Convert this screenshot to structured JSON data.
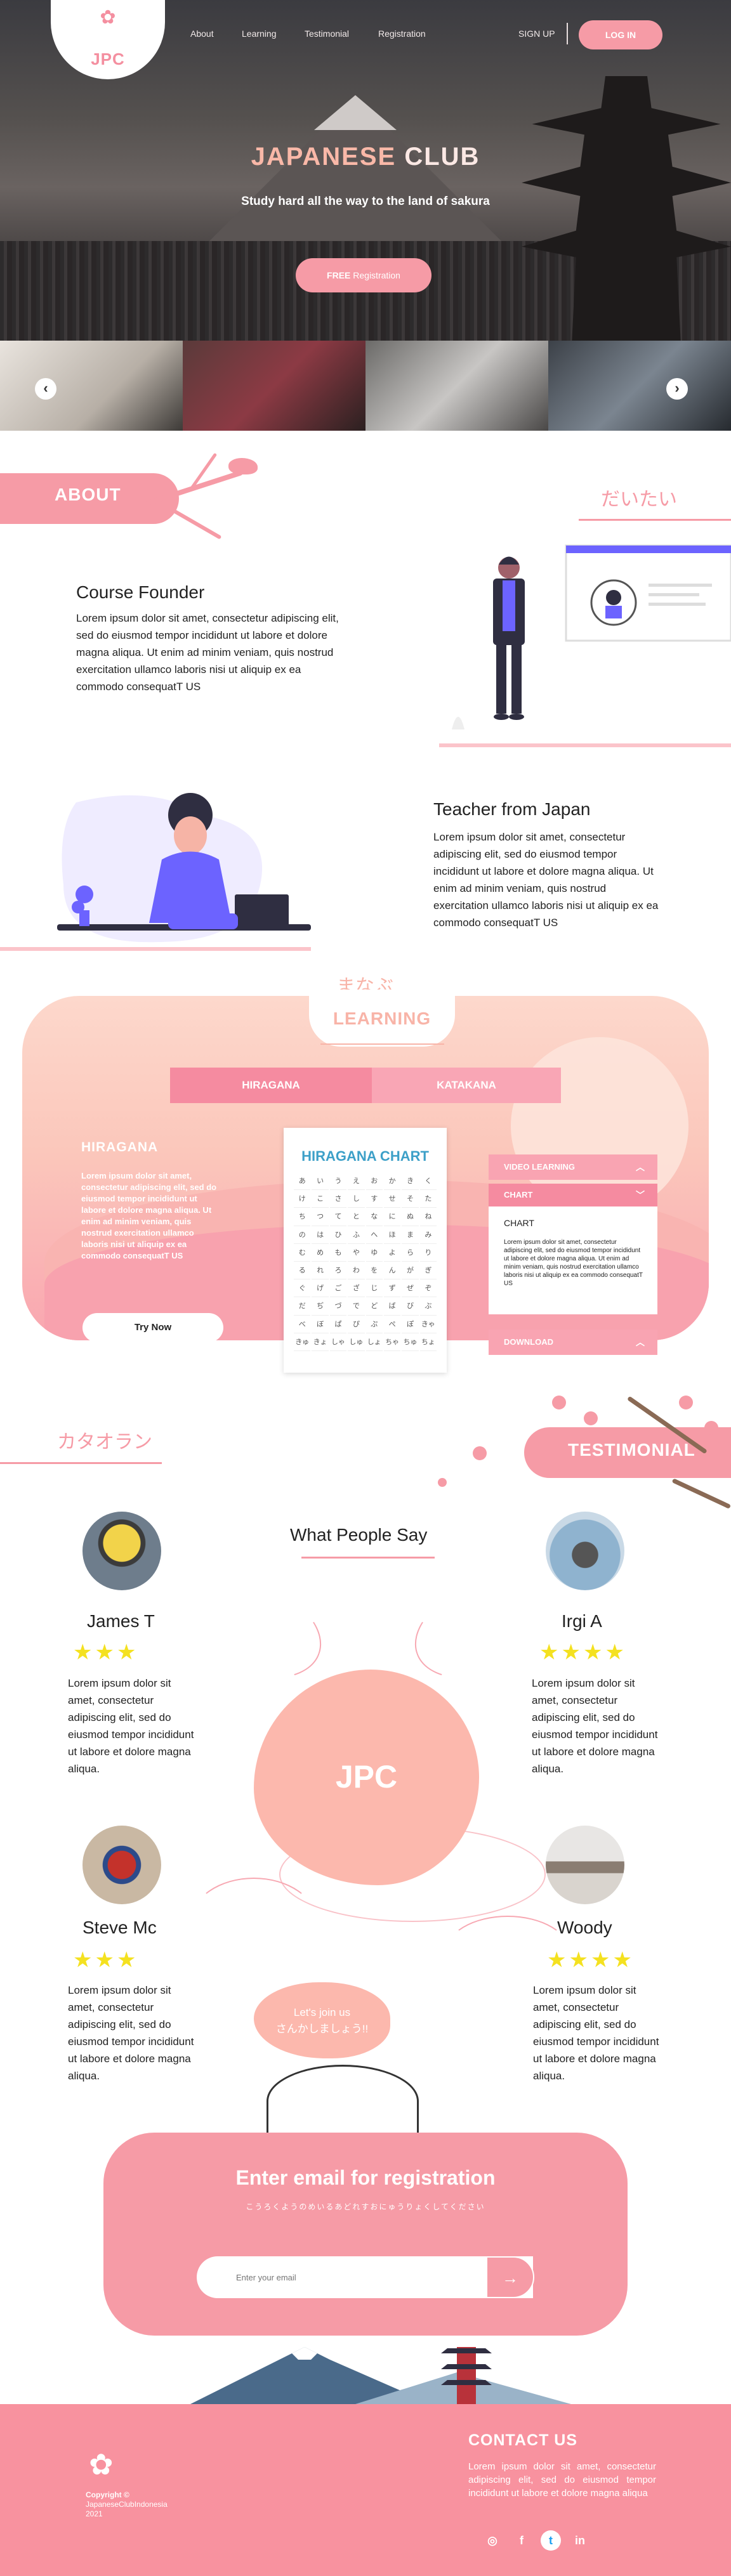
{
  "nav": {
    "logo": "JPC",
    "links": [
      "About",
      "Learning",
      "Testimonial",
      "Registration"
    ],
    "signup": "SIGN UP",
    "login": "LOG IN"
  },
  "hero": {
    "title_a": "JAPANESE",
    "title_b": " CLUB",
    "subtitle": "Study hard all the way to the land of sakura",
    "cta_bold": "FREE",
    "cta_rest": " Registration"
  },
  "about": {
    "title": "ABOUT",
    "jp": "だいたい",
    "founder_title": "Course Founder",
    "founder_text": "Lorem ipsum dolor sit amet, consectetur adipiscing elit, sed do eiusmod tempor incididunt ut labore et dolore magna aliqua. Ut enim ad minim veniam, quis nostrud exercitation ullamco laboris nisi ut aliquip ex ea commodo consequatT US",
    "teacher_title": "Teacher from Japan",
    "teacher_text": "Lorem ipsum dolor sit amet, consectetur adipiscing elit, sed do eiusmod tempor incididunt ut labore et dolore magna aliqua. Ut enim ad minim veniam, quis nostrud exercitation ullamco laboris nisi ut aliquip ex ea commodo consequatT US"
  },
  "learning": {
    "jp": "まなぶ",
    "title": "LEARNING",
    "tabs": [
      "HIRAGANA",
      "KATAKANA"
    ],
    "section_title": "HIRAGANA",
    "section_text": "Lorem ipsum dolor sit amet, consectetur adipiscing elit, sed do eiusmod tempor incididunt ut labore et dolore magna aliqua. Ut enim ad minim veniam, quis nostrud exercitation ullamco laboris nisi ut aliquip ex ea commodo consequatT US",
    "try_now": "Try Now",
    "chart_title": "HIRAGANA CHART",
    "chart_chars": [
      "あ",
      "い",
      "う",
      "え",
      "お",
      "か",
      "き",
      "く",
      "け",
      "こ",
      "さ",
      "し",
      "す",
      "せ",
      "そ",
      "た",
      "ち",
      "つ",
      "て",
      "と",
      "な",
      "に",
      "ぬ",
      "ね",
      "の",
      "は",
      "ひ",
      "ふ",
      "へ",
      "ほ",
      "ま",
      "み",
      "む",
      "め",
      "も",
      "や",
      "ゆ",
      "よ",
      "ら",
      "り",
      "る",
      "れ",
      "ろ",
      "わ",
      "を",
      "ん",
      "が",
      "ぎ",
      "ぐ",
      "げ",
      "ご",
      "ざ",
      "じ",
      "ず",
      "ぜ",
      "ぞ",
      "だ",
      "ぢ",
      "づ",
      "で",
      "ど",
      "ば",
      "び",
      "ぶ",
      "べ",
      "ぼ",
      "ぱ",
      "ぴ",
      "ぷ",
      "ぺ",
      "ぽ",
      "きゃ",
      "きゅ",
      "きょ",
      "しゃ",
      "しゅ",
      "しょ",
      "ちゃ",
      "ちゅ",
      "ちょ"
    ],
    "panel": {
      "video": "VIDEO LEARNING",
      "chart": "CHART",
      "chart_sub": "CHART",
      "chart_text": "Lorem ipsum dolor sit amet, consectetur adipiscing elit, sed do eiusmod tempor incididunt ut labore et dolore magna aliqua. Ut enim ad minim veniam, quis nostrud exercitation ullamco laboris nisi ut aliquip ex ea commodo consequatT US",
      "download": "DOWNLOAD"
    }
  },
  "testimonial": {
    "jp": "カタオラン",
    "title": "TESTIMONIAL",
    "heading": "What People Say",
    "center": "JPC",
    "people": [
      {
        "name": "James T",
        "stars": "★★★",
        "rating": 3,
        "text": "Lorem ipsum dolor sit amet, consectetur adipiscing elit, sed do eiusmod tempor incididunt ut labore et dolore magna aliqua."
      },
      {
        "name": "Irgi A",
        "stars": "★★★★",
        "rating": 4,
        "text": "Lorem ipsum dolor sit amet, consectetur adipiscing elit, sed do eiusmod tempor incididunt ut labore et dolore magna aliqua."
      },
      {
        "name": "Steve Mc",
        "stars": "★★★",
        "rating": 3,
        "text": "Lorem ipsum dolor sit amet, consectetur adipiscing elit, sed do eiusmod tempor incididunt ut labore et dolore magna aliqua."
      },
      {
        "name": "Woody",
        "stars": "★★★★",
        "rating": 4,
        "text": "Lorem ipsum dolor sit amet, consectetur adipiscing elit, sed do eiusmod tempor incididunt ut labore et dolore magna aliqua."
      }
    ],
    "join_line1": "Let's join us",
    "join_line2": "さんかしましょう!!"
  },
  "registration": {
    "title": "Enter email for registration",
    "subtitle": "こうろくようのめいるあどれすおにゅうりょくしてください",
    "placeholder": "Enter your email",
    "submit_icon": "→"
  },
  "footer": {
    "copyright_label": "Copyright ©",
    "copyright_owner": "JapaneseClubIndonesia",
    "copyright_year": "2021",
    "contact_title": "CONTACT US",
    "contact_text": "Lorem ipsum dolor sit amet, consectetur adipiscing elit, sed do eiusmod tempor incididunt ut labore et dolore magna aliqua",
    "socials": [
      "instagram-icon",
      "facebook-icon",
      "twitter-icon",
      "linkedin-icon"
    ]
  },
  "colors": {
    "accent": "#f69ba6",
    "peach": "#fcb8ad",
    "star": "#f4e120"
  }
}
